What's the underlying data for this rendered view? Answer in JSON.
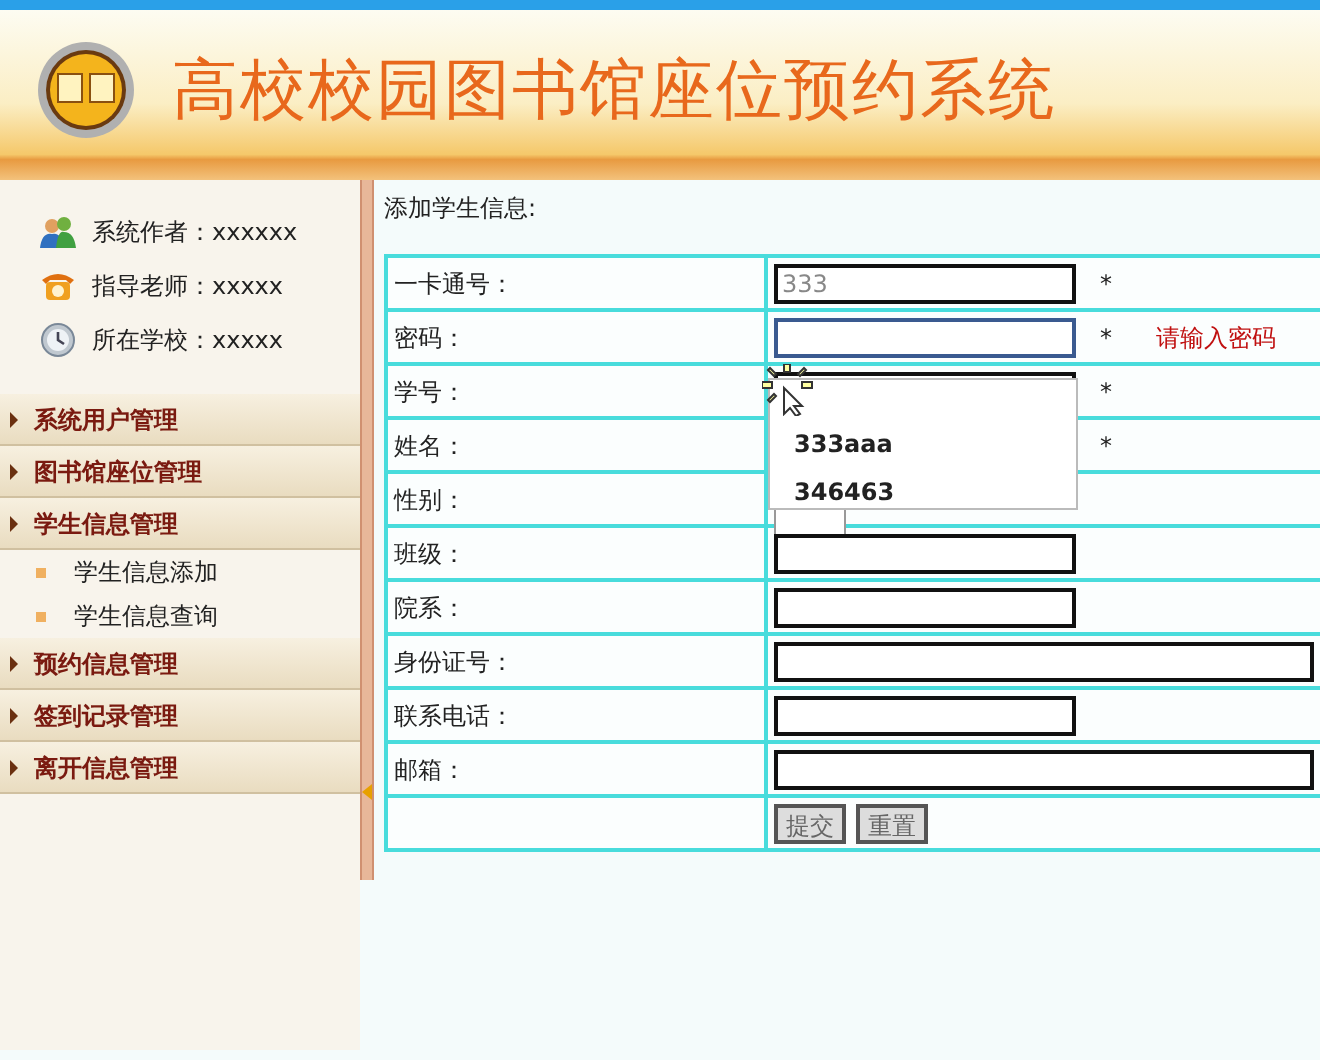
{
  "header": {
    "title": "高校校园图书馆座位预约系统"
  },
  "sidebar": {
    "info": [
      {
        "kind": "author",
        "text": "系统作者：xxxxxx"
      },
      {
        "kind": "teacher",
        "text": "指导老师：xxxxx"
      },
      {
        "kind": "school",
        "text": "所在学校：xxxxx"
      }
    ],
    "menu": [
      {
        "label": "系统用户管理"
      },
      {
        "label": "图书馆座位管理"
      },
      {
        "label": "学生信息管理",
        "children": [
          {
            "label": "学生信息添加"
          },
          {
            "label": "学生信息查询"
          }
        ]
      },
      {
        "label": "预约信息管理"
      },
      {
        "label": "签到记录管理"
      },
      {
        "label": "离开信息管理"
      }
    ]
  },
  "form": {
    "heading": "添加学生信息:",
    "fields": [
      {
        "label": "一卡通号：",
        "kind": "text",
        "value": "333",
        "readonly": true,
        "required_mark": "*"
      },
      {
        "label": "密码：",
        "kind": "text",
        "focused": true,
        "required_mark": "*",
        "error": "请输入密码"
      },
      {
        "label": "学号：",
        "kind": "text",
        "required_mark": "*",
        "autocomplete": [
          "333aaa",
          "346463"
        ]
      },
      {
        "label": "姓名：",
        "kind": "covered",
        "required_mark": "*"
      },
      {
        "label": "性别：",
        "kind": "select"
      },
      {
        "label": "班级：",
        "kind": "text"
      },
      {
        "label": "院系：",
        "kind": "text"
      },
      {
        "label": "身份证号：",
        "kind": "wide_text"
      },
      {
        "label": "联系电话：",
        "kind": "text"
      },
      {
        "label": "邮箱：",
        "kind": "wide_text"
      }
    ],
    "buttons": [
      "提交",
      "重置"
    ]
  }
}
